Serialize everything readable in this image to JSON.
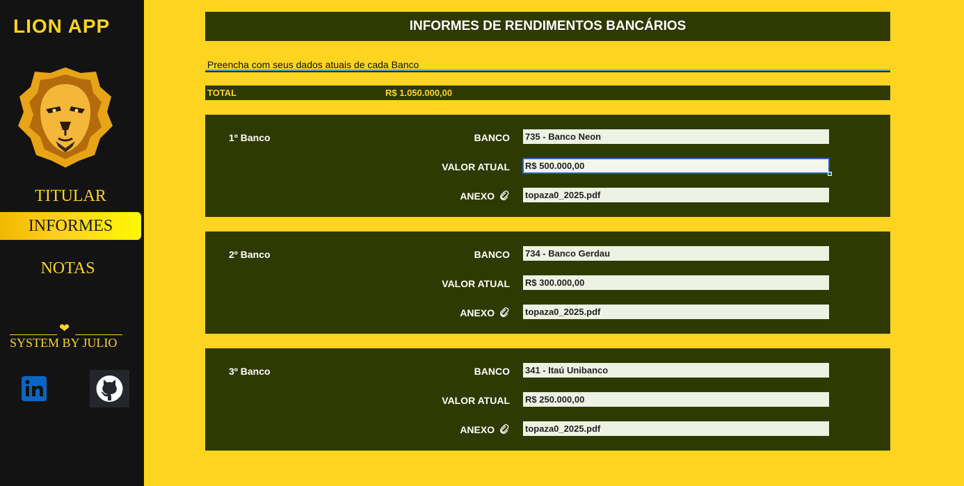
{
  "sidebar": {
    "app_title": "LION APP",
    "nav": [
      {
        "label": "TITULAR"
      },
      {
        "label": "INFORMES"
      },
      {
        "label": "NOTAS"
      }
    ],
    "credit": "SYSTEM BY JULIO",
    "active_nav": "INFORMES"
  },
  "header": {
    "title": "INFORMES DE RENDIMENTOS BANCÁRIOS"
  },
  "subtitle": "Preencha com seus dados atuais de cada Banco",
  "total": {
    "label": "TOTAL",
    "value": "R$ 1.050.000,00"
  },
  "field_labels": {
    "banco": "BANCO",
    "valor": "VALOR ATUAL",
    "anexo": "ANEXO"
  },
  "banks": [
    {
      "title": "1º Banco",
      "banco": "735 - Banco Neon",
      "valor": "R$ 500.000,00",
      "anexo": "topaza0_2025.pdf"
    },
    {
      "title": "2º Banco",
      "banco": "734 - Banco Gerdau",
      "valor": "R$ 300.000,00",
      "anexo": "topaza0_2025.pdf"
    },
    {
      "title": "3º Banco",
      "banco": "341 - Itaú Unibanco",
      "valor": "R$ 250.000,00",
      "anexo": "topaza0_2025.pdf"
    }
  ],
  "colors": {
    "accent": "#fdd41f",
    "panel": "#2f3a02",
    "sidebar": "#131313"
  },
  "icons": [
    "lion-logo",
    "heart-icon",
    "linkedin-icon",
    "github-icon",
    "paperclip-icon"
  ]
}
